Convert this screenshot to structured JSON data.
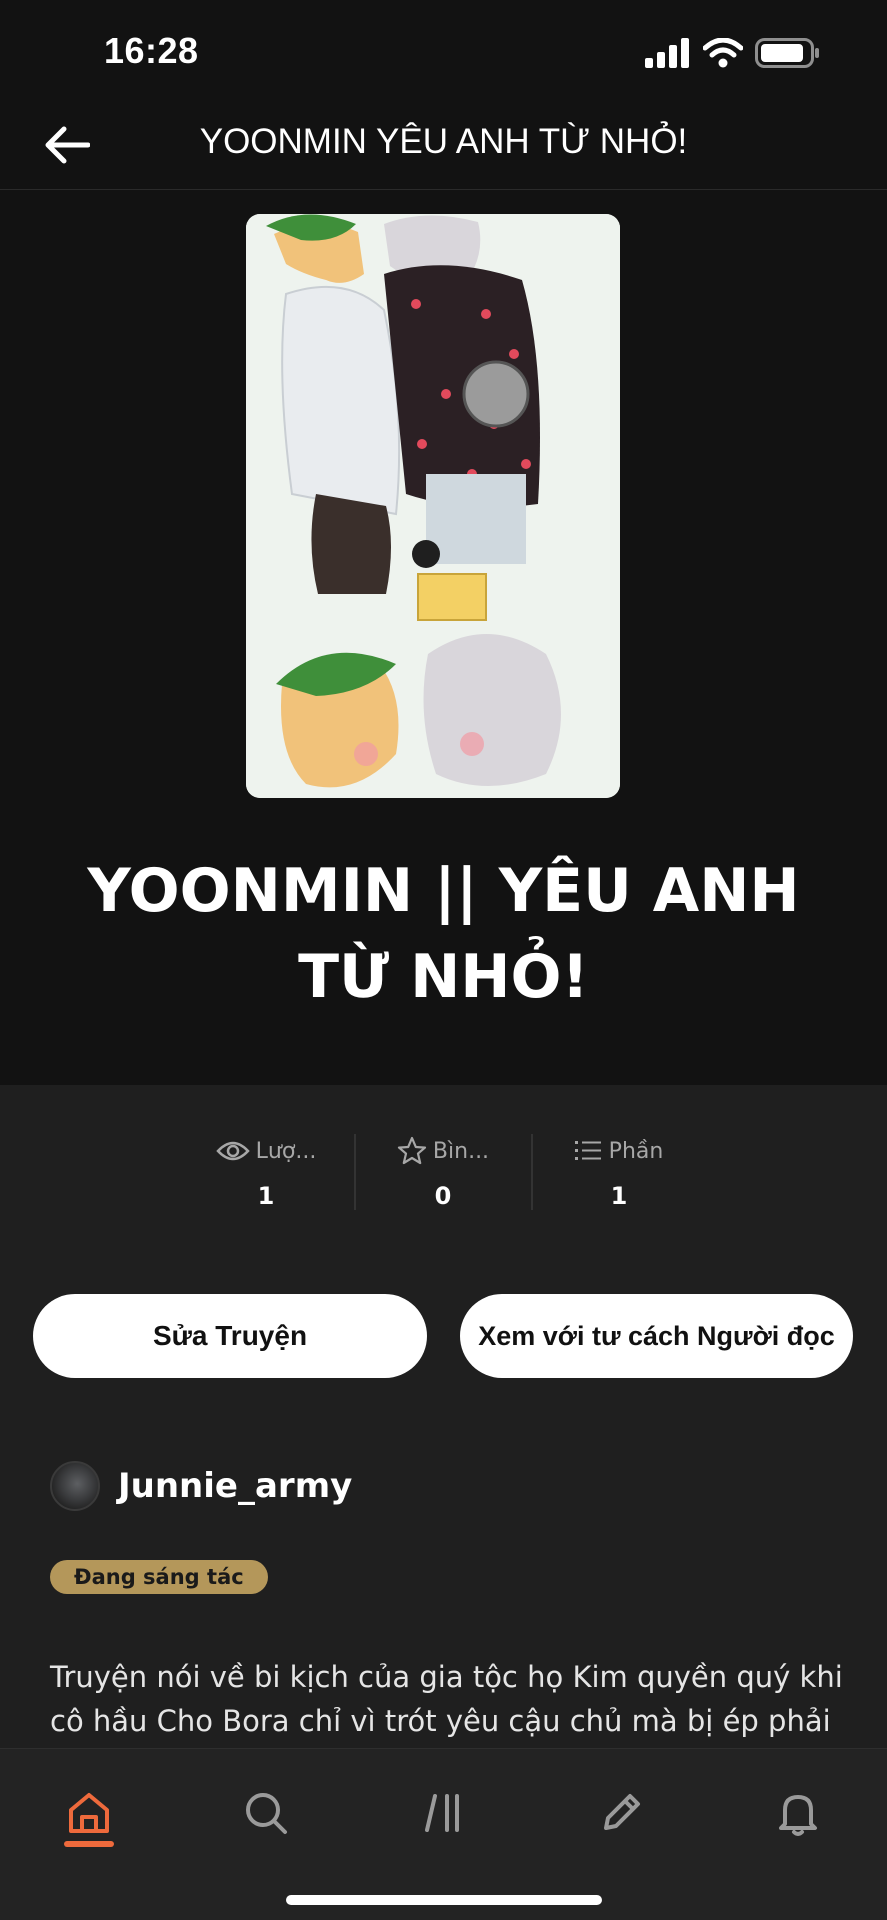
{
  "status_bar": {
    "time": "16:28"
  },
  "header": {
    "title": "YOONMIN  YÊU ANH TỪ NHỎ!"
  },
  "story": {
    "title_line1": "YOONMIN || YÊU ANH",
    "title_line2": "TỪ NHỎ!"
  },
  "stats": [
    {
      "icon": "eye-icon",
      "label": "Lượ...",
      "value": "1"
    },
    {
      "icon": "star-icon",
      "label": "Bìn...",
      "value": "0"
    },
    {
      "icon": "list-icon",
      "label": "Phần",
      "value": "1"
    }
  ],
  "actions": {
    "edit_label": "Sửa Truyện",
    "view_label": "Xem với tư cách Người đọc"
  },
  "author": {
    "name": "Junnie_army"
  },
  "status_badge": "Đang sáng tác",
  "description": "Truyện nói về bi kịch của gia tộc họ Kim quyền quý khi cô hầu Cho Bora chỉ vì trót yêu cậu chủ mà bị ép phải tự tử.",
  "tabs": [
    {
      "icon": "home-icon",
      "active": true
    },
    {
      "icon": "search-icon",
      "active": false
    },
    {
      "icon": "library-icon",
      "active": false
    },
    {
      "icon": "pencil-icon",
      "active": false
    },
    {
      "icon": "bell-icon",
      "active": false
    }
  ],
  "colors": {
    "background": "#121212",
    "panel": "#1f1f1f",
    "accent": "#ee6a3c",
    "badge": "#b4975a"
  }
}
